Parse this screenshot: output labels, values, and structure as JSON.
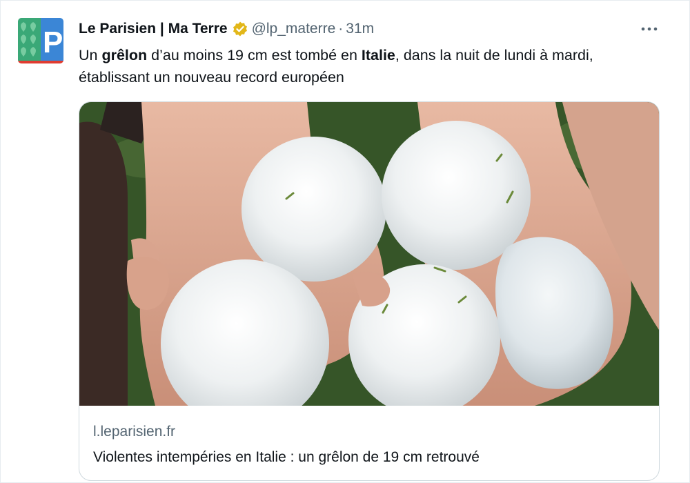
{
  "tweet": {
    "author_name": "Le Parisien | Ma Terre",
    "handle": "@lp_materre",
    "separator": "·",
    "time": "31m",
    "avatar_letter": "P",
    "text_parts": [
      {
        "t": "Un ",
        "bold": false
      },
      {
        "t": "grêlon",
        "bold": true
      },
      {
        "t": " d’au moins 19 cm est tombé en ",
        "bold": false
      },
      {
        "t": "Italie",
        "bold": true
      },
      {
        "t": ", dans la nuit de lundi à mardi, établissant un nouveau record européen",
        "bold": false
      }
    ],
    "verified_color": "#e2b719",
    "more_icon": "ellipsis-icon"
  },
  "card": {
    "domain": "l.leparisien.fr",
    "title": "Violentes intempéries en Italie : un grêlon de 19 cm retrouvé",
    "image_alt": "hailstones-in-hands-photo"
  },
  "colors": {
    "text": "#0f1419",
    "secondary": "#536471",
    "border": "#cfd9de",
    "avatar_green": "#2e9e6b",
    "avatar_blue": "#3a86d1",
    "avatar_red": "#e03c31"
  }
}
